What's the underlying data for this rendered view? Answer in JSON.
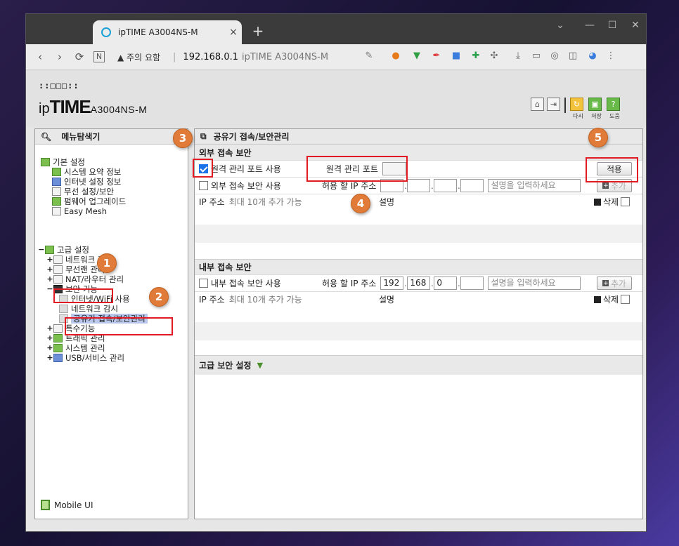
{
  "browser": {
    "tab_title": "ipTIME A3004NS-M",
    "tab_close": "×",
    "new_tab": "+",
    "controls": {
      "list": "⌄",
      "minimize": "—",
      "maximize": "☐",
      "close": "✕"
    },
    "nav": {
      "back": "‹",
      "forward": "›",
      "reload": "⟳",
      "reader": "N"
    },
    "address": {
      "warning": "▲ 주의 요함",
      "separator": "|",
      "host": "192.168.0.1",
      "title": "ipTIME A3004NS-M"
    }
  },
  "header": {
    "logo_dots": "::□□□::",
    "logo_prefix": "ip",
    "logo_main": "TIME",
    "logo_model": "A3004NS-M",
    "buttons": [
      {
        "label": "다시"
      },
      {
        "label": "저장"
      },
      {
        "label": "도움"
      }
    ]
  },
  "left_panel": {
    "title": "메뉴탐색기",
    "basic": {
      "label": "기본 설정",
      "items": [
        "시스템 요약 정보",
        "인터넷 설정 정보",
        "무선 설정/보안",
        "펌웨어 업그레이드",
        "Easy Mesh"
      ]
    },
    "advanced": {
      "label": "고급 설정",
      "items": [
        {
          "label": "네트워크 관리",
          "toggle": "+"
        },
        {
          "label": "무선랜 관리",
          "toggle": "+"
        },
        {
          "label": "NAT/라우터 관리",
          "toggle": "+"
        },
        {
          "label": "보안 기능",
          "toggle": "−"
        },
        {
          "label": "인터넷/WiFi 사용",
          "toggle": ""
        },
        {
          "label": "네트워크 감시",
          "toggle": ""
        },
        {
          "label": "공유기 접속/보안관리",
          "toggle": ""
        },
        {
          "label": "특수기능",
          "toggle": "+"
        },
        {
          "label": "트래픽 관리",
          "toggle": "+"
        },
        {
          "label": "시스템 관리",
          "toggle": "+"
        },
        {
          "label": "USB/서비스 관리",
          "toggle": "+"
        }
      ]
    },
    "mobile_ui": "Mobile UI"
  },
  "right_panel": {
    "title": "공유기 접속/보안관리",
    "external": {
      "section": "외부 접속 보안",
      "remote_port_use_label": "원격 관리 포트 사용",
      "remote_port_use_checked": true,
      "remote_port_label": "원격 관리 포트",
      "remote_port_value": "",
      "apply_label": "적용",
      "ext_security_label": "외부 접속 보안 사용",
      "allow_ip_label": "허용 할 IP 주소",
      "ip": [
        "",
        "",
        "",
        ""
      ],
      "desc_placeholder": "설명을 입력하세요",
      "add_label": "추가",
      "list_ip_header": "IP 주소",
      "list_ip_note": "최대 10개 추가 가능",
      "list_desc_header": "설명",
      "delete_label": "삭제"
    },
    "internal": {
      "section": "내부 접속 보안",
      "int_security_label": "내부 접속 보안 사용",
      "allow_ip_label": "허용 할 IP 주소",
      "ip": [
        "192",
        "168",
        "0",
        ""
      ],
      "desc_placeholder": "설명을 입력하세요",
      "add_label": "추가",
      "list_ip_header": "IP 주소",
      "list_ip_note": "최대 10개 추가 가능",
      "list_desc_header": "설명",
      "delete_label": "삭제"
    },
    "advanced_section": "고급 보안 설정",
    "advanced_toggle": "▼"
  },
  "annotations": [
    "1",
    "2",
    "3",
    "4",
    "5"
  ],
  "colors": {
    "badge": "#e07b39",
    "highlight": "#e01b24",
    "selected": "#b9c7ea"
  }
}
